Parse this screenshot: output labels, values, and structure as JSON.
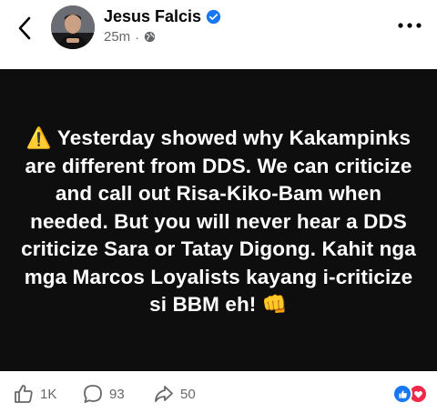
{
  "header": {
    "author_name": "Jesus Falcis",
    "timestamp": "25m",
    "separator": "·",
    "privacy_icon": "globe-icon",
    "back_icon": "chevron-left-icon",
    "more_icon": "more-horizontal-icon",
    "verified_color": "#1877f2"
  },
  "post": {
    "background_color": "#0e0e0e",
    "text_color": "#ffffff",
    "text": "⚠️ Yesterday showed why Kakampinks are different from DDS. We can criticize and call out Risa-Kiko-Bam when needed. But you will never hear a DDS criticize Sara or Tatay Digong. Kahit nga mga Marcos Loyalists kayang i-criticize si BBM eh! 👊"
  },
  "footer": {
    "like_count": "1K",
    "comment_count": "93",
    "share_count": "50",
    "like_icon": "thumbs-up-icon",
    "comment_icon": "comment-bubble-icon",
    "share_icon": "share-arrow-icon",
    "reactions": [
      "like",
      "love"
    ],
    "like_color": "#1877f2",
    "love_color": "#f0284a"
  }
}
